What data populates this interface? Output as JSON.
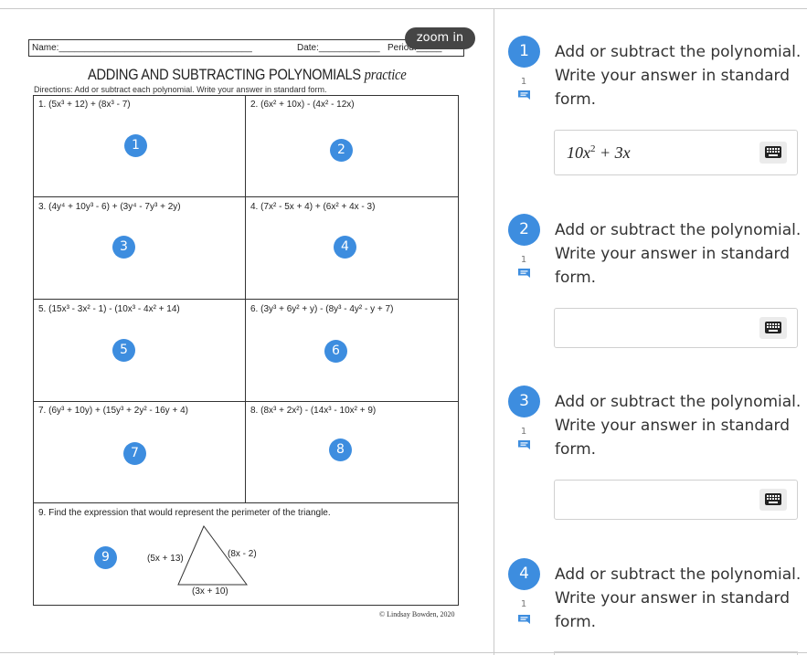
{
  "worksheet": {
    "zoom_label": "zoom in",
    "name_label": "Name:______________________________________",
    "date_label": "Date:____________",
    "period_label": "Period:_____",
    "title_main": "ADDING AND SUBTRACTING POLYNOMIALS",
    "title_script": "practice",
    "directions": "Directions: Add or subtract each polynomial. Write your answer in standard form.",
    "problems": [
      "1. (5x³ + 12) + (8x³ - 7)",
      "2. (6x² + 10x) - (4x² - 12x)",
      "3. (4y⁴ + 10y³ - 6) + (3y⁴ - 7y³ + 2y)",
      "4. (7x² - 5x + 4) + (6x² + 4x - 3)",
      "5. (15x³ - 3x² - 1) - (10x³ - 4x² + 14)",
      "6. (3y³ + 6y² + y) - (8y³ - 4y² - y + 7)",
      "7. (6y³ + 10y) + (15y³ + 2y² - 16y + 4)",
      "8. (8x³ + 2x²) - (14x³ - 10x² + 9)",
      "9. Find the expression that would represent the perimeter of the triangle."
    ],
    "markers": [
      "1",
      "2",
      "3",
      "4",
      "5",
      "6",
      "7",
      "8",
      "9"
    ],
    "triangle": {
      "left_side": "(5x + 13)",
      "right_side": "(8x - 2)",
      "base": "(3x + 10)"
    },
    "credit": "© Lindsay Bowden, 2020"
  },
  "questions": [
    {
      "number": "1",
      "comment_count": "1",
      "prompt": "Add or subtract the polynomial. Write your answer in standard form.",
      "answer_base": "10x",
      "answer_exp": "2",
      "answer_tail": " + 3x"
    },
    {
      "number": "2",
      "comment_count": "1",
      "prompt": "Add or subtract the polynomial. Write your answer in standard form.",
      "answer": ""
    },
    {
      "number": "3",
      "comment_count": "1",
      "prompt": "Add or subtract the polynomial. Write your answer in standard form.",
      "answer": ""
    },
    {
      "number": "4",
      "comment_count": "1",
      "prompt": "Add or subtract the polynomial. Write your answer in standard form."
    }
  ],
  "icons": {
    "comment": "comment-icon",
    "keyboard": "keyboard-icon"
  },
  "colors": {
    "accent": "#3d8ddf",
    "zoom_bg": "#454545"
  }
}
